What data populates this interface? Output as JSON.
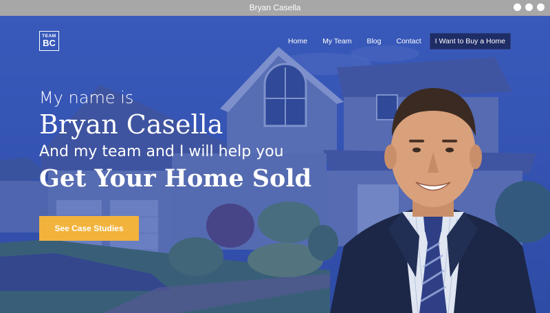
{
  "window": {
    "title": "Bryan Casella"
  },
  "logo": {
    "line1": "TEAM",
    "line2": "BC"
  },
  "nav": {
    "items": [
      "Home",
      "My Team",
      "Blog",
      "Contact"
    ],
    "cta": "I Want to Buy a Home"
  },
  "hero": {
    "line_a": "My name is",
    "line_b": "Bryan Casella",
    "line_c": "And my team and I will help you",
    "line_d": "Get Your Home Sold",
    "button": "See Case Studies"
  },
  "colors": {
    "overlay": "#2a48aa",
    "button": "#f2b33d",
    "nav_cta_bg": "#1f2d66",
    "titlebar": "#a7a7a7"
  }
}
